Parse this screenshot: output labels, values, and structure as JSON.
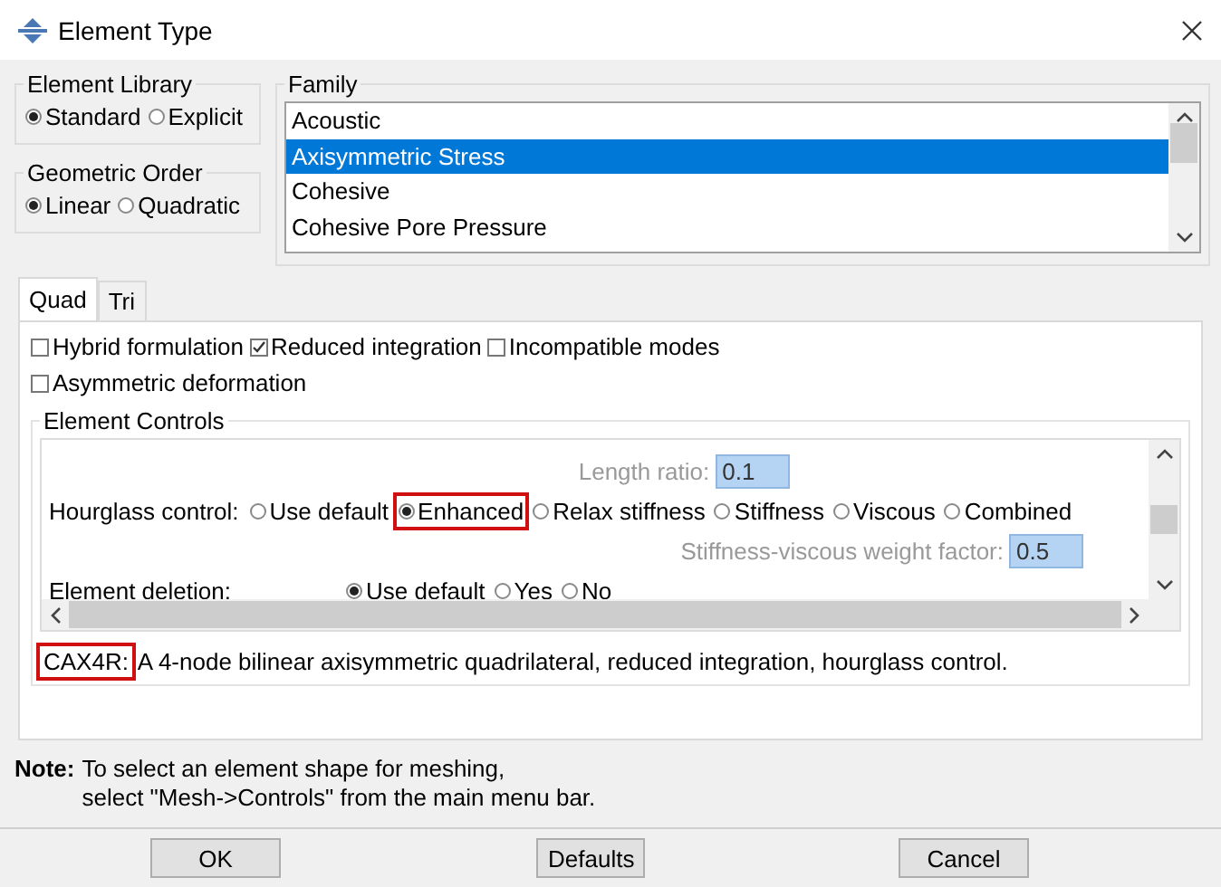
{
  "window": {
    "title": "Element Type"
  },
  "element_library": {
    "label": "Element Library",
    "options": [
      {
        "label": "Standard",
        "selected": true
      },
      {
        "label": "Explicit",
        "selected": false
      }
    ]
  },
  "geometric_order": {
    "label": "Geometric Order",
    "options": [
      {
        "label": "Linear",
        "selected": true
      },
      {
        "label": "Quadratic",
        "selected": false
      }
    ]
  },
  "family": {
    "label": "Family",
    "items": [
      {
        "label": "Acoustic",
        "selected": false
      },
      {
        "label": "Axisymmetric Stress",
        "selected": true
      },
      {
        "label": "Cohesive",
        "selected": false
      },
      {
        "label": "Cohesive Pore Pressure",
        "selected": false
      }
    ]
  },
  "tabs": [
    {
      "label": "Quad",
      "selected": true
    },
    {
      "label": "Tri",
      "selected": false
    }
  ],
  "options": [
    {
      "label": "Hybrid formulation",
      "checked": false
    },
    {
      "label": "Reduced integration",
      "checked": true
    },
    {
      "label": "Incompatible modes",
      "checked": false
    },
    {
      "label": "Asymmetric deformation",
      "checked": false
    }
  ],
  "element_controls": {
    "label": "Element Controls",
    "length_ratio": {
      "label": "Length ratio:",
      "value": "0.1",
      "disabled": true
    },
    "hourglass": {
      "label": "Hourglass control:",
      "options": [
        {
          "label": "Use default",
          "selected": false,
          "highlighted": false
        },
        {
          "label": "Enhanced",
          "selected": true,
          "highlighted": true
        },
        {
          "label": "Relax stiffness",
          "selected": false,
          "highlighted": false
        },
        {
          "label": "Stiffness",
          "selected": false,
          "highlighted": false
        },
        {
          "label": "Viscous",
          "selected": false,
          "highlighted": false
        },
        {
          "label": "Combined",
          "selected": false,
          "highlighted": false
        }
      ]
    },
    "weight_factor": {
      "label": "Stiffness-viscous weight factor:",
      "value": "0.5",
      "disabled": true
    },
    "deletion": {
      "label": "Element deletion:",
      "options": [
        {
          "label": "Use default",
          "selected": true
        },
        {
          "label": "Yes",
          "selected": false
        },
        {
          "label": "No",
          "selected": false
        }
      ]
    }
  },
  "description": {
    "code": "CAX4R:",
    "highlighted": true,
    "text": "A 4-node bilinear axisymmetric quadrilateral, reduced integration, hourglass control."
  },
  "note": {
    "label": "Note:",
    "lines": [
      "To select an element shape for meshing,",
      "select \"Mesh->Controls\" from the main menu bar."
    ]
  },
  "buttons": [
    "OK",
    "Defaults",
    "Cancel"
  ]
}
